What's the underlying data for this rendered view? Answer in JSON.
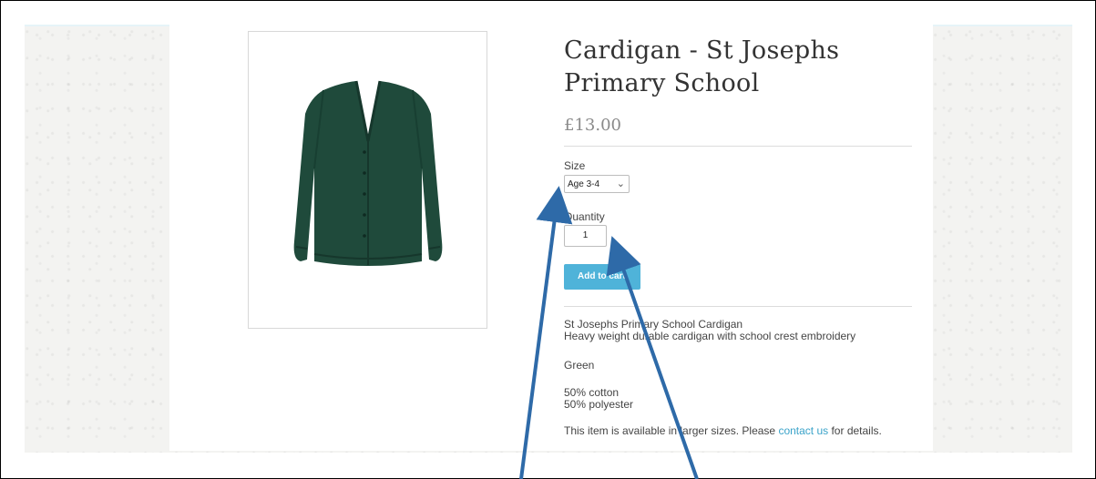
{
  "product": {
    "title_line1": "Cardigan - St Josephs",
    "title_line2": "Primary School",
    "price": "£13.00",
    "image_icon": "green-cardigan-image",
    "color": "#1f4a3b"
  },
  "options": {
    "size_label": "Size",
    "size_selected": "Age 3-4",
    "quantity_label": "Quantity",
    "quantity_value": "1",
    "add_to_cart_label": "Add to cart"
  },
  "description": {
    "line1": "St Josephs Primary School Cardigan",
    "line2": "Heavy weight durable cardigan with school crest embroidery",
    "color_text": "Green",
    "material1": "50% cotton",
    "material2": "50% polyester",
    "availability_before": "This item is available in larger sizes. Please ",
    "availability_link": "contact us",
    "availability_after": " for details."
  },
  "theme": {
    "accent": "#4fb3d9",
    "link": "#3aa3c9",
    "annotation_arrow": "#2e6aa8"
  }
}
